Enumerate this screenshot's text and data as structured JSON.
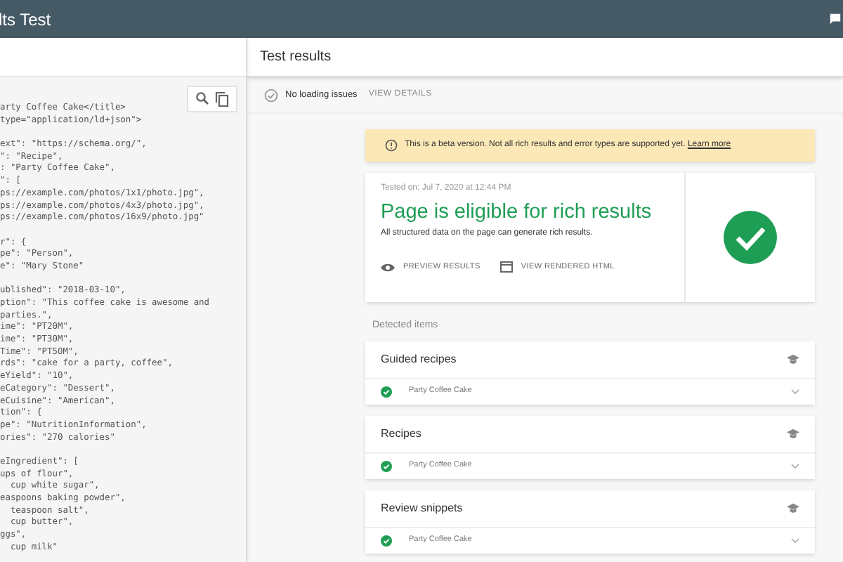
{
  "header": {
    "title": "lts Test"
  },
  "code": {
    "blocks": [
      [
        "arty Coffee Cake</title>",
        "type=\"application/ld+json\">"
      ],
      [
        "ext\": \"https://schema.org/\",",
        "\": \"Recipe\",",
        ": \"Party Coffee Cake\",",
        "\": [",
        "ps://example.com/photos/1x1/photo.jpg\",",
        "ps://example.com/photos/4x3/photo.jpg\",",
        "ps://example.com/photos/16x9/photo.jpg\""
      ],
      [
        "r\": {",
        "pe\": \"Person\",",
        "e\": \"Mary Stone\""
      ],
      [
        "ublished\": \"2018-03-10\",",
        "ption\": \"This coffee cake is awesome and",
        "parties.\",",
        "ime\": \"PT20M\",",
        "ime\": \"PT30M\",",
        "Time\": \"PT50M\",",
        "rds\": \"cake for a party, coffee\",",
        "eYield\": \"10\",",
        "eCategory\": \"Dessert\",",
        "eCuisine\": \"American\",",
        "tion\": {",
        "pe\": \"NutritionInformation\",",
        "ories\": \"270 calories\""
      ],
      [
        "eIngredient\": [",
        "ups of flour\",",
        "  cup white sugar\",",
        "easpoons baking powder\",",
        "  teaspoon salt\",",
        "  cup butter\",",
        "ggs\",",
        "  cup milk\""
      ]
    ]
  },
  "results": {
    "title": "Test results",
    "loading": {
      "label": "No loading issues",
      "action": "VIEW DETAILS"
    },
    "banner": {
      "text": "This is a beta version. Not all rich results and error types are supported yet.",
      "link": "Learn more"
    },
    "summary": {
      "tested_on": "Tested on: Jul 7, 2020 at 12:44 PM",
      "headline": "Page is eligible for rich results",
      "description": "All structured data on the page can generate rich results.",
      "actions": [
        {
          "kind": "preview",
          "label": "PREVIEW RESULTS"
        },
        {
          "kind": "html",
          "label": "VIEW RENDERED HTML"
        }
      ]
    },
    "detected_label": "Detected items",
    "items": [
      {
        "title": "Guided recipes",
        "entry": "Party Coffee Cake"
      },
      {
        "title": "Recipes",
        "entry": "Party Coffee Cake"
      },
      {
        "title": "Review snippets",
        "entry": "Party Coffee Cake"
      }
    ]
  }
}
